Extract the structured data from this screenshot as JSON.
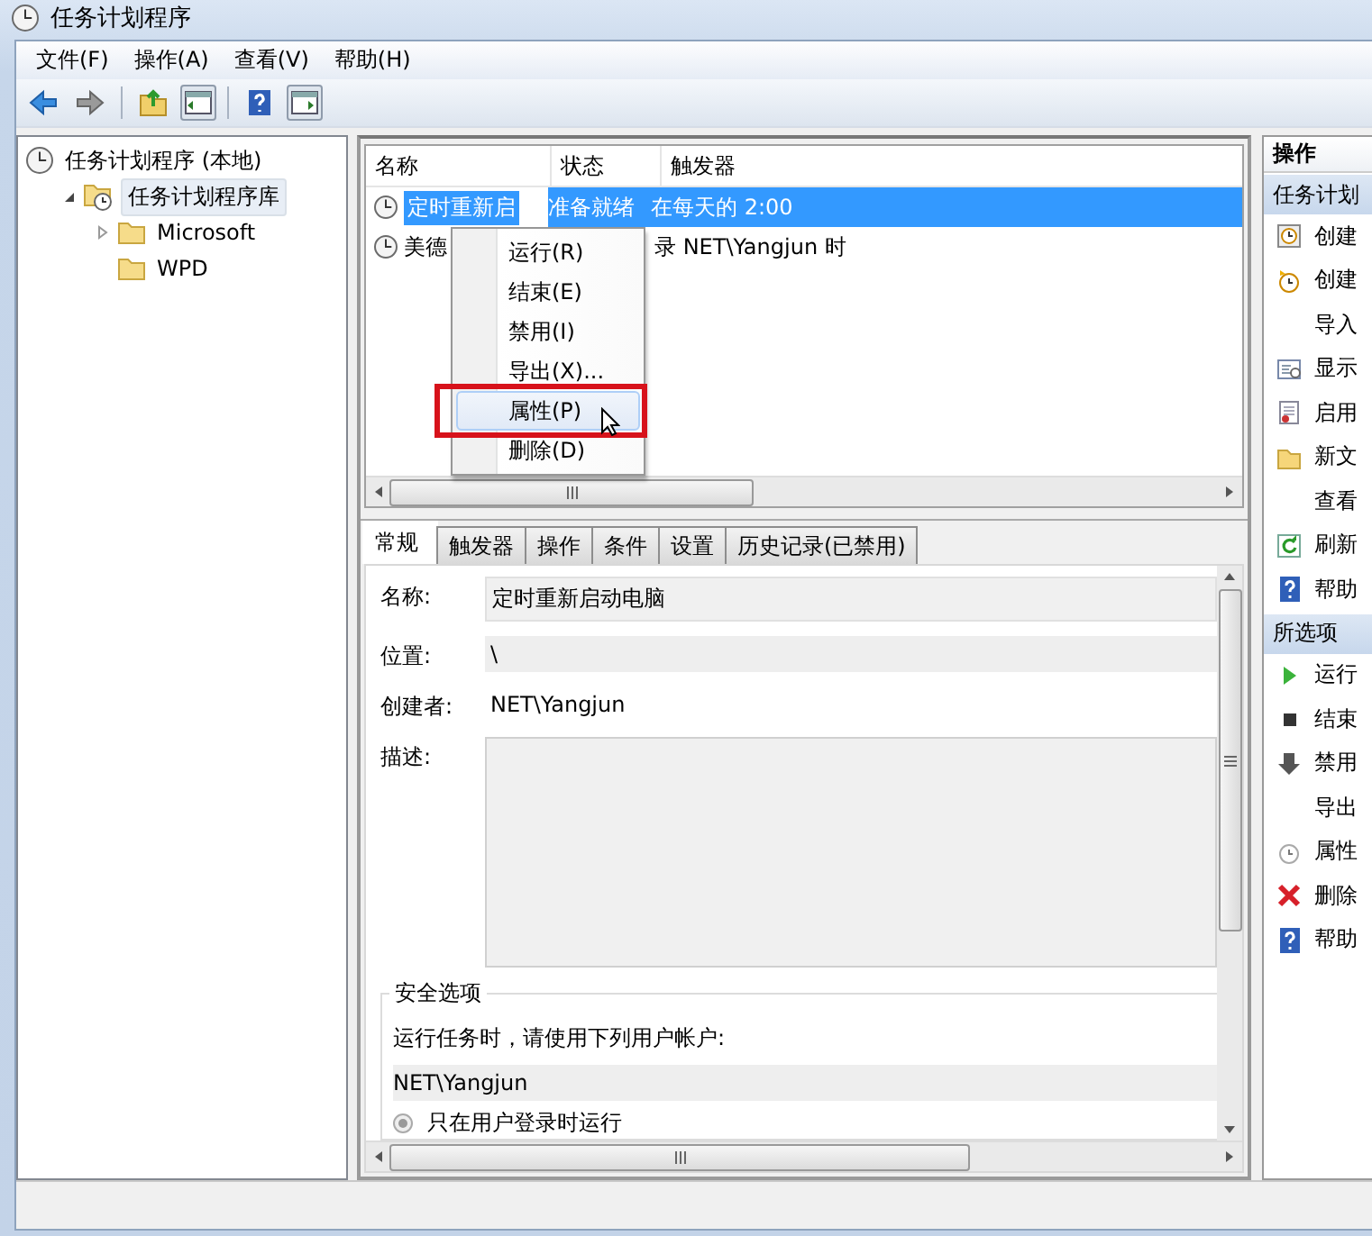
{
  "window": {
    "title": "任务计划程序"
  },
  "menu": [
    "文件(F)",
    "操作(A)",
    "查看(V)",
    "帮助(H)"
  ],
  "tree": [
    {
      "label": "任务计划程序 (本地)",
      "selected": false,
      "children": [
        {
          "label": "任务计划程序库",
          "expanded": true,
          "selected": true,
          "children": [
            {
              "label": "Microsoft",
              "expanded": false,
              "selected": false
            },
            {
              "label": "WPD",
              "selected": false
            }
          ]
        }
      ]
    }
  ],
  "task_list": {
    "columns": [
      "名称",
      "状态",
      "触发器"
    ],
    "rows": [
      {
        "name": "定时重新启",
        "status": "准备就绪",
        "trigger": "在每天的 2:00",
        "selected": true
      },
      {
        "name": "美德",
        "trigger": "录 NET\\Yangjun 时",
        "selected": false
      }
    ]
  },
  "context_menu": {
    "items": [
      {
        "label": "运行(R)",
        "selected": false,
        "outlined": false
      },
      {
        "label": "结束(E)",
        "selected": false,
        "outlined": false
      },
      {
        "label": "禁用(I)",
        "selected": false,
        "outlined": false
      },
      {
        "label": "导出(X)...",
        "selected": false,
        "outlined": false
      },
      {
        "label": "属性(P)",
        "selected": true,
        "outlined": true
      },
      {
        "label": "删除(D)",
        "selected": false,
        "outlined": false
      }
    ]
  },
  "detail": {
    "tabs": [
      {
        "label": "常规",
        "selected": true
      },
      {
        "label": "触发器",
        "selected": false
      },
      {
        "label": "操作",
        "selected": false
      },
      {
        "label": "条件",
        "selected": false
      },
      {
        "label": "设置",
        "selected": false
      },
      {
        "label": "历史记录(已禁用)",
        "selected": false
      }
    ],
    "fields": [
      {
        "label": "名称:",
        "value": "定时重新启动电脑",
        "kind": "box"
      },
      {
        "label": "位置:",
        "value": "\\",
        "kind": "band"
      },
      {
        "label": "创建者:",
        "value": "NET\\Yangjun",
        "kind": "plain"
      },
      {
        "label": "描述:",
        "kind": "area"
      }
    ],
    "security": {
      "title": "安全选项",
      "prompt": "运行任务时，请使用下列用户帐户:",
      "account": "NET\\Yangjun",
      "options": [
        {
          "label": "只在用户登录时运行",
          "selected": true
        }
      ]
    }
  },
  "actions": {
    "title": "操作",
    "sections": [
      {
        "title": "任务计划",
        "items": [
          "创建",
          "创建",
          "导入",
          "显示",
          "启用",
          "新文",
          "查看",
          "刷新",
          "帮助"
        ]
      },
      {
        "title": "所选项",
        "items": [
          "运行",
          "结束",
          "禁用",
          "导出",
          "属性",
          "删除",
          "帮助"
        ]
      }
    ]
  }
}
